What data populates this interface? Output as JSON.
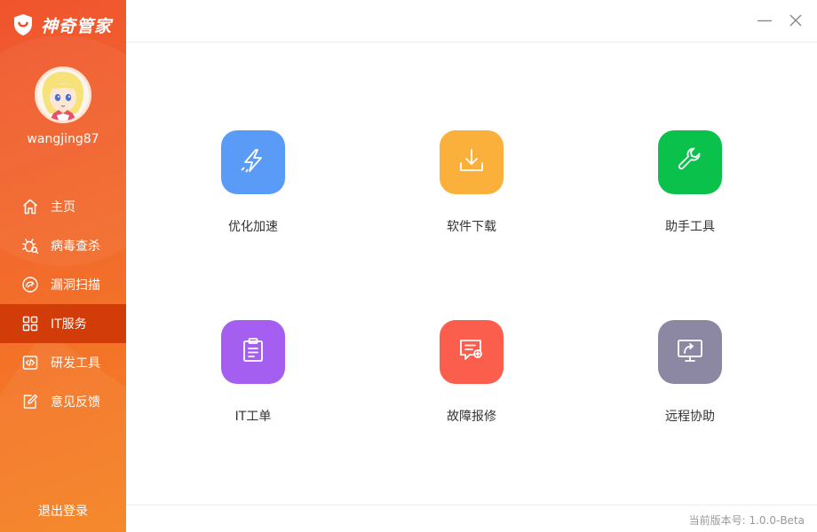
{
  "app": {
    "name": "神奇管家",
    "version_text": "当前版本号: 1.0.0-Beta"
  },
  "user": {
    "username": "wangjing87"
  },
  "sidebar": {
    "items": [
      {
        "label": "主页",
        "icon": "home-icon",
        "active": false
      },
      {
        "label": "病毒查杀",
        "icon": "virus-icon",
        "active": false
      },
      {
        "label": "漏洞扫描",
        "icon": "scan-icon",
        "active": false
      },
      {
        "label": "IT服务",
        "icon": "grid-icon",
        "active": true
      },
      {
        "label": "研发工具",
        "icon": "code-icon",
        "active": false
      },
      {
        "label": "意见反馈",
        "icon": "feedback-icon",
        "active": false
      }
    ],
    "logout_label": "退出登录"
  },
  "tiles": [
    {
      "label": "优化加速",
      "icon": "lightning-icon",
      "color": "#5b9bf8"
    },
    {
      "label": "软件下载",
      "icon": "download-icon",
      "color": "#fbb03b"
    },
    {
      "label": "助手工具",
      "icon": "wrench-icon",
      "color": "#0ac24b"
    },
    {
      "label": "IT工单",
      "icon": "clipboard-icon",
      "color": "#a45ff0"
    },
    {
      "label": "故障报修",
      "icon": "repair-message-icon",
      "color": "#fb5e4c"
    },
    {
      "label": "远程协助",
      "icon": "remote-screen-icon",
      "color": "#8c88a4"
    }
  ],
  "colors": {
    "sidebar_top": "#f0542e",
    "sidebar_bottom": "#f5821f",
    "active_item": "#d13c08"
  }
}
